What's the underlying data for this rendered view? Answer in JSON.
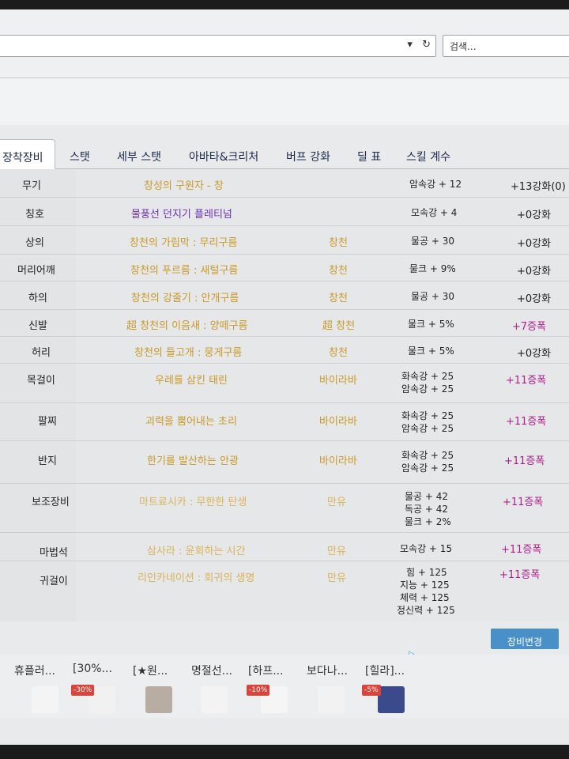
{
  "browser": {
    "search_placeholder": "검색...",
    "dropdown_icon": "▾",
    "reload_icon": "↻"
  },
  "tabs": [
    {
      "label": "장착장비",
      "active": true
    },
    {
      "label": "스탯"
    },
    {
      "label": "세부 스탯"
    },
    {
      "label": "아바타&크리처"
    },
    {
      "label": "버프 강화"
    },
    {
      "label": "딜 표"
    },
    {
      "label": "스킬 계수"
    }
  ],
  "equipment": [
    {
      "slot": "무기",
      "item": "창성의 구원자 - 창",
      "set": "",
      "stats": [
        "암속강 + 12"
      ],
      "enhance": "+13강화(0)"
    },
    {
      "slot": "칭호",
      "item": "물풍선 던지기 플레티넘",
      "set": "",
      "stats": [
        "모속강 + 4"
      ],
      "enhance": "+0강화"
    },
    {
      "slot": "상의",
      "item": "창천의 가림막 : 무리구름",
      "set": "창천",
      "stats": [
        "물공 + 30"
      ],
      "enhance": "+0강화"
    },
    {
      "slot": "머리어깨",
      "item": "창천의 푸르름 : 새털구름",
      "set": "창천",
      "stats": [
        "물크 + 9%"
      ],
      "enhance": "+0강화"
    },
    {
      "slot": "하의",
      "item": "창천의 강줄기 : 안개구름",
      "set": "창천",
      "stats": [
        "물공 + 30"
      ],
      "enhance": "+0강화"
    },
    {
      "slot": "신발",
      "item": "超 창천의 이음새 : 양떼구름",
      "set": "超 창천",
      "stats": [
        "물크 + 5%"
      ],
      "enhance": "+7증폭"
    },
    {
      "slot": "허리",
      "item": "창천의 들고개 : 뭉게구름",
      "set": "창천",
      "stats": [
        "물크 + 5%"
      ],
      "enhance": "+0강화"
    },
    {
      "slot": "목걸이",
      "item": "우레를 삼킨 태린",
      "set": "바이라바",
      "stats": [
        "화속강 + 25",
        "암속강 + 25"
      ],
      "enhance": "+11증폭"
    },
    {
      "slot": "팔찌",
      "item": "괴력을 뿜어내는 초리",
      "set": "바이라바",
      "stats": [
        "화속강 + 25",
        "암속강 + 25"
      ],
      "enhance": "+11증폭"
    },
    {
      "slot": "반지",
      "item": "한기를 발산하는 안광",
      "set": "바이라바",
      "stats": [
        "화속강 + 25",
        "암속강 + 25"
      ],
      "enhance": "+11증폭"
    },
    {
      "slot": "보조장비",
      "item": "마트료시카 : 무한한 탄생",
      "set": "만유",
      "stats": [
        "물공 + 42",
        "독공 + 42",
        "물크 + 2%"
      ],
      "enhance": "+11증폭"
    },
    {
      "slot": "마법석",
      "item": "삼사라 : 윤회하는 시간",
      "set": "만유",
      "stats": [
        "모속강 + 15"
      ],
      "enhance": "+11증폭"
    },
    {
      "slot": "귀걸이",
      "item": "리인카네이션 : 회귀의 생명",
      "set": "만유",
      "stats": [
        "힘 + 125",
        "지능 + 125",
        "체력 + 125",
        "정신력 + 125"
      ],
      "enhance": "+11증폭"
    }
  ],
  "change_button": "장비변경",
  "ad": {
    "ad_mark": "▷",
    "items": [
      {
        "title": "휴플러...",
        "badge": ""
      },
      {
        "title": "[30%...",
        "badge": "-30%"
      },
      {
        "title": "[★원...",
        "badge": ""
      },
      {
        "title": "명절선...",
        "badge": ""
      },
      {
        "title": "[하프...",
        "badge": "-10%"
      },
      {
        "title": "보다나...",
        "badge": ""
      },
      {
        "title": "[힐라]...",
        "badge": "-5%"
      }
    ]
  },
  "colors": {
    "item_orange": "#c89a2a",
    "item_purple": "#6a2fb8",
    "amplify_magenta": "#b0208c",
    "button_blue": "#4a90c8"
  }
}
